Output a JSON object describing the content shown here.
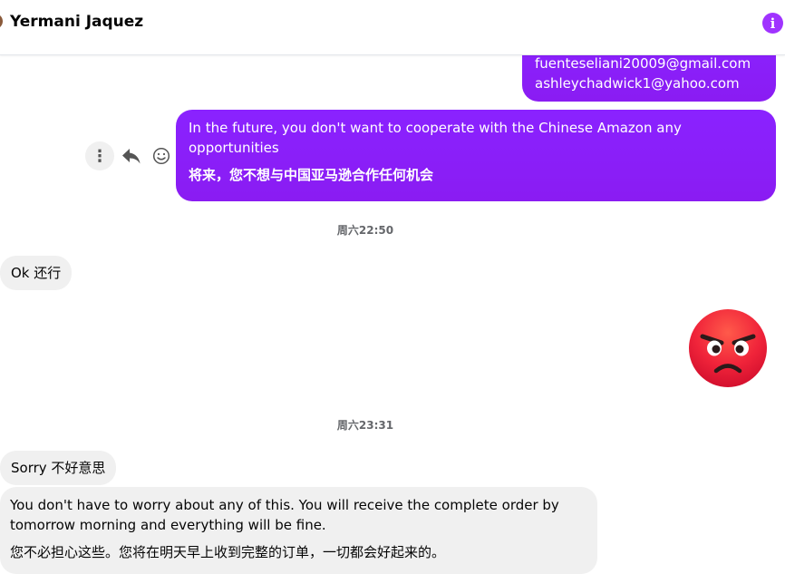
{
  "header": {
    "contact_name": "Yermani Jaquez",
    "info_icon": "info-icon",
    "accent_color": "#a033ff"
  },
  "messages": {
    "emails": {
      "line1": "fuenteseliani20009@gmail.com",
      "line2": "ashleychadwick1@yahoo.com"
    },
    "future": {
      "en": "In the future, you don't want to cooperate with the Chinese Amazon any opportunities",
      "cn": "将来，您不想与中国亚马逊合作任何机会"
    },
    "timestamp1": "周六22:50",
    "ok": "Ok  还行",
    "angry_emoji": "angry-face",
    "timestamp2": "周六23:31",
    "sorry": "Sorry  不好意思",
    "worry": {
      "en": "You don't have to worry about any of this. You will receive the complete order by tomorrow morning and everything will be fine.",
      "cn": "您不必担心这些。您将在明天早上收到完整的订单，一切都会好起来的。"
    }
  },
  "actions": {
    "more_icon": "more-vertical-icon",
    "reply_icon": "reply-icon",
    "react_icon": "smiley-icon"
  },
  "colors": {
    "outgoing_bubble": "#8a1cf2",
    "incoming_bubble": "#f0f0f0",
    "timestamp_text": "#65676b"
  }
}
